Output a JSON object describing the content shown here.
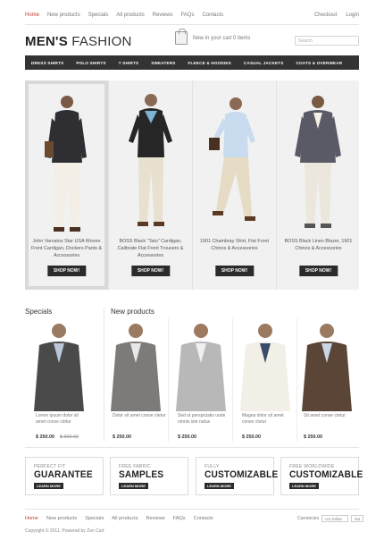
{
  "top_nav": [
    "Home",
    "New products",
    "Specials",
    "All products",
    "Reviews",
    "FAQs",
    "Contacts"
  ],
  "top_right": [
    "Checkout",
    "Login"
  ],
  "logo": {
    "bold": "MEN'S",
    "light": "FASHION"
  },
  "cart": {
    "text": "New in your cart 0 items"
  },
  "search": {
    "placeholder": "Search"
  },
  "categories": [
    "DRESS SHIRTS",
    "POLO SHIRTS",
    "T SHIRTS",
    "SWEATERS",
    "FLEECE & HOODIES",
    "CASUAL JACKETS",
    "COATS & OVERWEAR"
  ],
  "hero": {
    "items": [
      {
        "caption": "John Varvatos Star USA Woven Front Cardigan, Dockers Pants & Accessories",
        "button": "SHOP NOW!",
        "active": true
      },
      {
        "caption": "BOSS Black \"Tatu\" Cardigan, Calibrate Flat Front Trousers & Accessories",
        "button": "SHOP NOW!",
        "active": false
      },
      {
        "caption": "1901 Chambray Shirt, Flat Front Chinos & Accessories",
        "button": "SHOP NOW!",
        "active": false
      },
      {
        "caption": "BOSS Black Linen Blazer, 1901 Chinos & Accessories",
        "button": "SHOP NOW!",
        "active": false
      }
    ]
  },
  "sections": {
    "specials": "Specials",
    "new_products": "New products"
  },
  "specials": [
    {
      "desc": "Lorem ipsum dolor sit amet conse ctetur",
      "price": "$ 250.00",
      "old_price": "$ 300.00"
    }
  ],
  "new_products": [
    {
      "desc": "Dolor sit amet conse ctetur",
      "price": "$ 250.00"
    },
    {
      "desc": "Sed ut perspiciatis unde omnis iste natus",
      "price": "$ 250.00"
    },
    {
      "desc": "Magna dolor sit amet conse ctetur",
      "price": "$ 250.00"
    },
    {
      "desc": "Sit amet conse ctetur",
      "price": "$ 250.00"
    }
  ],
  "features": [
    {
      "small": "PERFECT FIT",
      "big": "GUARANTEE",
      "button": "LEARN MORE"
    },
    {
      "small": "FREE FABRIC",
      "big": "SAMPLES",
      "button": "LEARN MORE"
    },
    {
      "small": "FULLY",
      "big": "CUSTOMIZABLE",
      "button": "LEARN MORE"
    },
    {
      "small": "FREE WORLDWIDE",
      "big": "CUSTOMIZABLE",
      "button": "LEARN MORE"
    }
  ],
  "footer": {
    "nav": [
      "Home",
      "New products",
      "Specials",
      "All products",
      "Reviews",
      "FAQs",
      "Contacts"
    ],
    "currency_label": "Currencies",
    "currency_value": "US Dollar",
    "currency_go": "Go",
    "copyright": "Copyright © 2011. Powered by Zen Cart"
  },
  "colors": {
    "accent": "#c0392b",
    "dark_bar": "#333333",
    "button": "#2b2b2b"
  }
}
